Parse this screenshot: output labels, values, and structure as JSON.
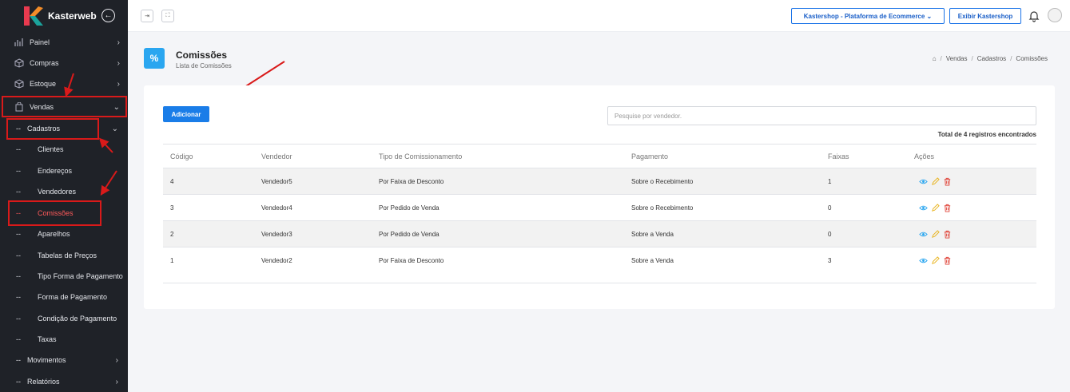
{
  "app": {
    "name": "Kasterweb"
  },
  "sidebar": {
    "items": [
      {
        "label": "Painel",
        "chevron": "›"
      },
      {
        "label": "Compras",
        "chevron": "›"
      },
      {
        "label": "Estoque",
        "chevron": "›"
      },
      {
        "label": "Vendas",
        "chevron": "⌄"
      }
    ],
    "group": {
      "dash": "--",
      "label": "Cadastros",
      "chevron": "⌄"
    },
    "subitems": [
      {
        "dash": "--",
        "label": "Clientes"
      },
      {
        "dash": "--",
        "label": "Endereços"
      },
      {
        "dash": "--",
        "label": "Vendedores"
      },
      {
        "dash": "--",
        "label": "Comissões",
        "active": true
      },
      {
        "dash": "--",
        "label": "Aparelhos"
      },
      {
        "dash": "--",
        "label": "Tabelas de Preços"
      },
      {
        "dash": "--",
        "label": "Tipo Forma de Pagamento"
      },
      {
        "dash": "--",
        "label": "Forma de Pagamento"
      },
      {
        "dash": "--",
        "label": "Condição de Pagamento"
      },
      {
        "dash": "--",
        "label": "Taxas"
      }
    ],
    "bottom": [
      {
        "dash": "--",
        "label": "Movimentos",
        "chevron": "›"
      },
      {
        "dash": "--",
        "label": "Relatórios",
        "chevron": "›"
      }
    ]
  },
  "topbar": {
    "store_select": "Kastershop - Plataforma de Ecommerce ⌄",
    "exibir_button": "Exibir Kastershop"
  },
  "page": {
    "title": "Comissões",
    "subtitle": "Lista de Comissões",
    "breadcrumb": [
      "Vendas",
      "Cadastros",
      "Comissões"
    ],
    "breadcrumb_sep": "/"
  },
  "toolbar": {
    "add_label": "Adicionar",
    "search_placeholder": "Pesquise por vendedor.",
    "total_text": "Total de 4 registros encontrados"
  },
  "table": {
    "headers": [
      "Código",
      "Vendedor",
      "Tipo de Comissionamento",
      "Pagamento",
      "Faixas",
      "Ações"
    ],
    "rows": [
      [
        "4",
        "Vendedor5",
        "Por Faixa de Desconto",
        "Sobre o Recebimento",
        "1"
      ],
      [
        "3",
        "Vendedor4",
        "Por Pedido de Venda",
        "Sobre o Recebimento",
        "0"
      ],
      [
        "2",
        "Vendedor3",
        "Por Pedido de Venda",
        "Sobre a Venda",
        "0"
      ],
      [
        "1",
        "Vendedor2",
        "Por Faixa de Desconto",
        "Sobre a Venda",
        "3"
      ]
    ]
  },
  "colors": {
    "sidebar_bg": "#1f2228",
    "accent_blue": "#1a7de8",
    "active_red": "#ff5a5a",
    "annotation_red": "#d91a1a",
    "view_icon": "#2aa6f0",
    "edit_icon": "#e8b21a",
    "delete_icon": "#e0453a"
  }
}
